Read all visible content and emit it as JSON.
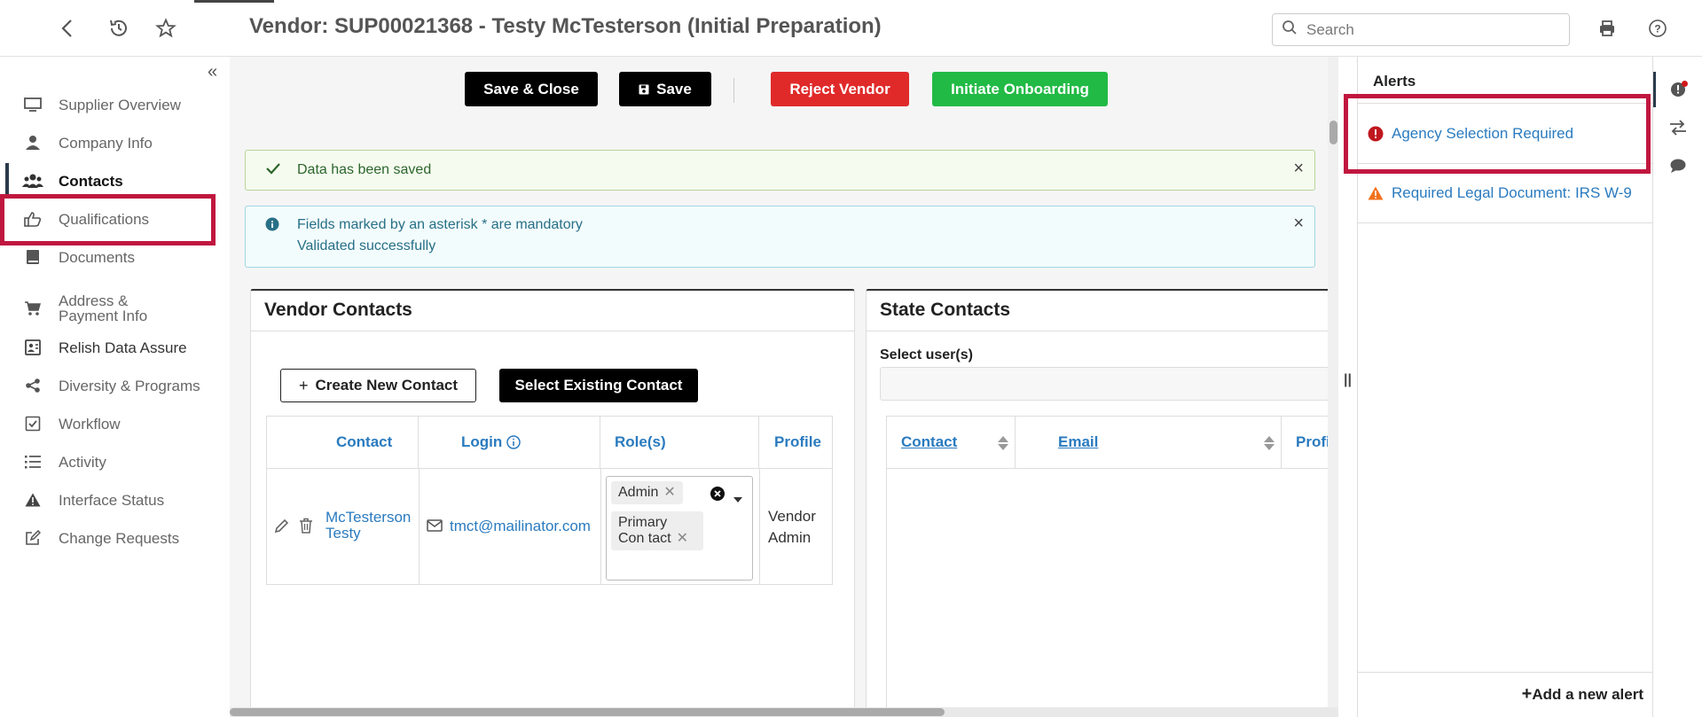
{
  "header": {
    "title": "Vendor: SUP00021368 - Testy McTesterson (Initial Preparation)",
    "search_placeholder": "Search"
  },
  "sidebar": {
    "items": [
      {
        "label": "Supplier Overview",
        "icon": "monitor-icon"
      },
      {
        "label": "Company Info",
        "icon": "user-icon"
      },
      {
        "label": "Contacts",
        "icon": "users-icon",
        "active": true
      },
      {
        "label": "Qualifications",
        "icon": "thumbs-up-icon"
      },
      {
        "label": "Documents",
        "icon": "book-icon"
      },
      {
        "label": "Address & Payment Info",
        "icon": "cart-icon"
      },
      {
        "label": "Relish Data Assure",
        "icon": "id-card-icon"
      },
      {
        "label": "Diversity & Programs",
        "icon": "share-icon"
      },
      {
        "label": "Workflow",
        "icon": "check-square-icon"
      },
      {
        "label": "Activity",
        "icon": "list-icon"
      },
      {
        "label": "Interface Status",
        "icon": "warning-icon"
      },
      {
        "label": "Change Requests",
        "icon": "edit-icon"
      }
    ]
  },
  "toolbar": {
    "save_close": "Save & Close",
    "save": "Save",
    "reject": "Reject Vendor",
    "onboard": "Initiate Onboarding"
  },
  "messages": {
    "success": "Data has been saved",
    "info_line1": "Fields marked by an asterisk * are mandatory",
    "info_line2": "Validated successfully"
  },
  "vendor_contacts": {
    "title": "Vendor Contacts",
    "create_label": "Create New Contact",
    "select_label": "Select Existing Contact",
    "columns": [
      "Contact",
      "Login",
      "Role(s)",
      "Profile"
    ],
    "row": {
      "contact_line1": "McTesterson",
      "contact_line2": "Testy",
      "email": "tmct@mailinator.com",
      "roles": [
        "Admin",
        "Primary Con tact"
      ],
      "profile_line1": "Vendor",
      "profile_line2": "Admin"
    }
  },
  "state_contacts": {
    "title": "State Contacts",
    "select_label": "Select user(s)",
    "columns": [
      "Contact",
      "Email",
      "Profi"
    ]
  },
  "alerts": {
    "title": "Alerts",
    "items": [
      {
        "label": "Agency Selection Required",
        "level": "error",
        "color": "#c0171f"
      },
      {
        "label": "Required Legal Document: IRS W-9",
        "level": "warning",
        "color": "#f2711c"
      }
    ],
    "add_label": "Add a new alert"
  },
  "colors": {
    "highlight": "#c0173f",
    "link": "#2a7bbf",
    "reject": "#e02a2a",
    "onboard": "#21ba45"
  }
}
